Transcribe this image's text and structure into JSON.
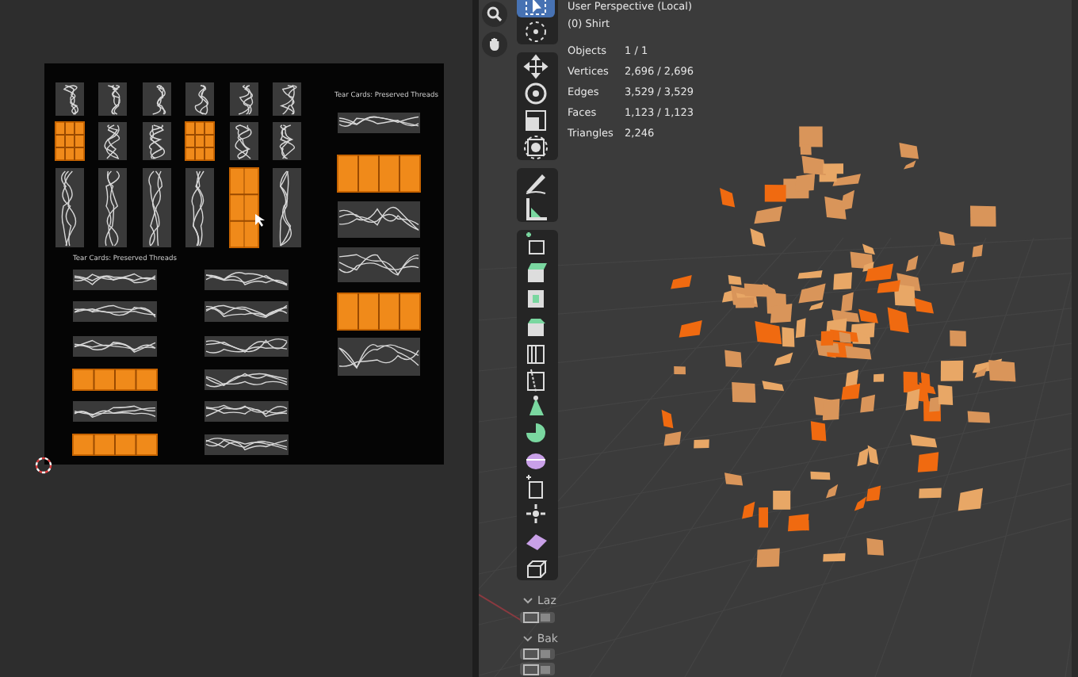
{
  "image_editor": {
    "image": {
      "sections": [
        {
          "title": "Tear Cards: Preserved Threads"
        },
        {
          "title": "Tear Cards: Preserved Threads"
        }
      ]
    }
  },
  "viewport": {
    "view_name": "User Perspective (Local)",
    "object_name": "(0) Shirt",
    "stats": [
      {
        "label": "Objects",
        "value": "1 / 1"
      },
      {
        "label": "Vertices",
        "value": "2,696 / 2,696"
      },
      {
        "label": "Edges",
        "value": "3,529 / 3,529"
      },
      {
        "label": "Faces",
        "value": "1,123 / 1,123"
      },
      {
        "label": "Triangles",
        "value": "2,246"
      }
    ],
    "toolbar": {
      "groups": [
        {
          "tools": [
            {
              "kind": "select",
              "selected": true
            },
            {
              "kind": "cursor",
              "selected": false
            }
          ]
        },
        {
          "tools": [
            {
              "kind": "move",
              "selected": false
            },
            {
              "kind": "rotate",
              "selected": false
            },
            {
              "kind": "scale",
              "selected": false
            },
            {
              "kind": "transform",
              "selected": false
            }
          ]
        },
        {
          "tools": [
            {
              "kind": "annotate",
              "selected": false
            },
            {
              "kind": "measure",
              "selected": false
            }
          ]
        },
        {
          "tools": [
            {
              "kind": "add",
              "selected": false
            },
            {
              "kind": "extrude",
              "selected": false
            },
            {
              "kind": "inset",
              "selected": false
            },
            {
              "kind": "bevel",
              "selected": false
            },
            {
              "kind": "loopcut",
              "selected": false
            },
            {
              "kind": "knife",
              "selected": false
            },
            {
              "kind": "polybuild",
              "selected": false
            },
            {
              "kind": "spin",
              "selected": false
            },
            {
              "kind": "smooth",
              "selected": false
            },
            {
              "kind": "shrink",
              "selected": false
            },
            {
              "kind": "shear",
              "selected": false
            },
            {
              "kind": "rip",
              "selected": false
            },
            {
              "kind": "region",
              "selected": false
            }
          ]
        }
      ]
    },
    "panels": [
      {
        "label": "Laz",
        "buttons": [
          {
            "kind": "image"
          }
        ]
      },
      {
        "label": "Bak",
        "buttons": [
          {
            "kind": "image"
          },
          {
            "kind": "image"
          }
        ]
      }
    ]
  }
}
